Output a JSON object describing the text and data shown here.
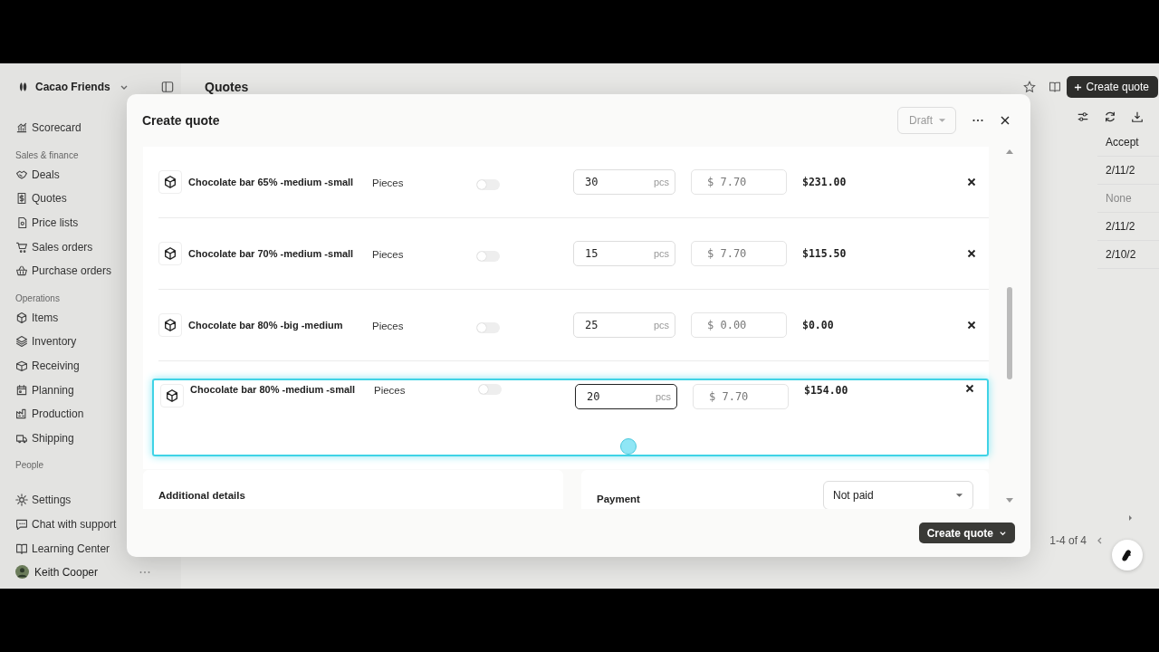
{
  "sidebar": {
    "org": "Cacao Friends",
    "groups": [
      {
        "items": [
          "Scorecard"
        ]
      },
      {
        "heading": "Sales & finance",
        "items": [
          "Deals",
          "Quotes",
          "Price lists",
          "Sales orders",
          "Purchase orders"
        ]
      },
      {
        "heading": "Operations",
        "items": [
          "Items",
          "Inventory",
          "Receiving",
          "Planning",
          "Production",
          "Shipping"
        ]
      },
      {
        "heading": "People"
      },
      {
        "items": [
          "Settings",
          "Chat with support",
          "Learning Center"
        ]
      }
    ],
    "user": "Keith Cooper"
  },
  "page": {
    "title": "Quotes",
    "create_button": "Create quote",
    "table": {
      "column": "Accept",
      "cells": [
        "2/11/2",
        "None",
        "2/11/2",
        "2/10/2"
      ]
    },
    "pagination": "1-4 of 4"
  },
  "modal": {
    "title": "Create quote",
    "status": "Draft",
    "rows": [
      {
        "name": "Chocolate bar 65% -medium -small",
        "unit": "Pieces",
        "on": false,
        "quantity": "30",
        "quantity_unit": "pcs",
        "price": "$ 7.70",
        "total": "$231.00",
        "selected": false,
        "focused": false
      },
      {
        "name": "Chocolate bar 70% -medium -small",
        "unit": "Pieces",
        "on": false,
        "quantity": "15",
        "quantity_unit": "pcs",
        "price": "$ 7.70",
        "total": "$115.50",
        "selected": false,
        "focused": false
      },
      {
        "name": "Chocolate bar 80% -big -medium",
        "unit": "Pieces",
        "on": false,
        "quantity": "25",
        "quantity_unit": "pcs",
        "price": "$ 0.00",
        "total": "$0.00",
        "selected": false,
        "focused": false
      },
      {
        "name": "Chocolate bar 80% -medium -small",
        "unit": "Pieces",
        "on": false,
        "quantity": "20",
        "quantity_unit": "pcs",
        "price": "$ 7.70",
        "total": "$154.00",
        "selected": true,
        "focused": true
      }
    ],
    "details_title": "Additional details",
    "payment": {
      "label": "Payment",
      "value": "Not paid"
    },
    "submit": "Create quote"
  }
}
